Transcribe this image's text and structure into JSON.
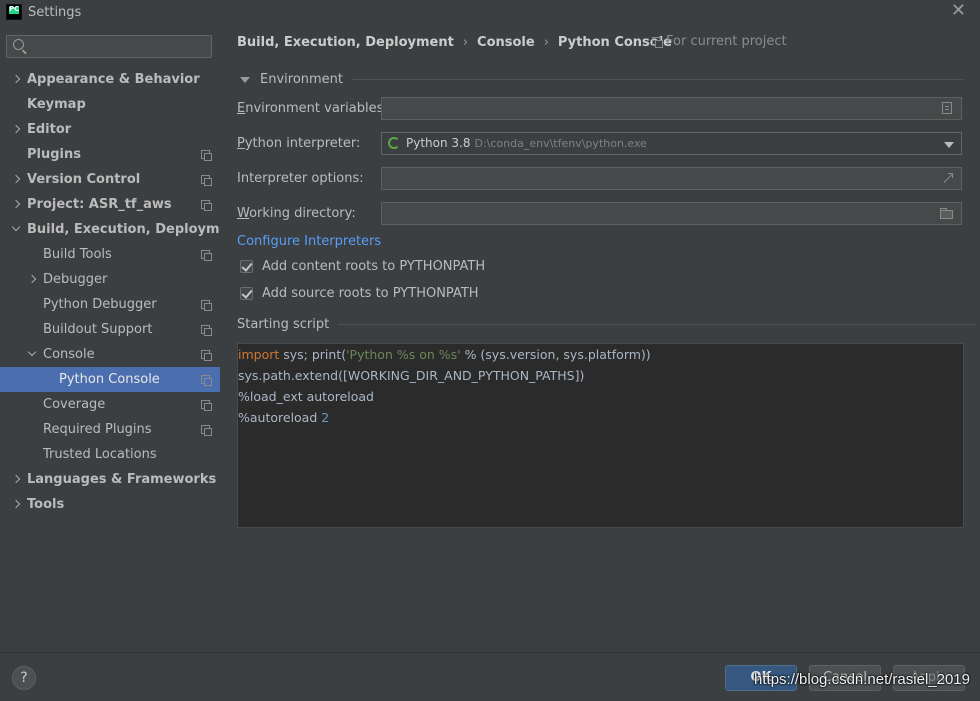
{
  "window": {
    "title": "Settings",
    "app_icon": "pycharm-icon",
    "close_icon": "close-icon"
  },
  "search": {
    "value": "",
    "placeholder": ""
  },
  "sidebar": {
    "items": [
      {
        "label": "Appearance & Behavior",
        "bold": true,
        "chevron": "right",
        "copy": false,
        "level": 0
      },
      {
        "label": "Keymap",
        "bold": true,
        "chevron": "none",
        "copy": false,
        "level": 0
      },
      {
        "label": "Editor",
        "bold": true,
        "chevron": "right",
        "copy": false,
        "level": 0
      },
      {
        "label": "Plugins",
        "bold": true,
        "chevron": "none",
        "copy": true,
        "level": 0
      },
      {
        "label": "Version Control",
        "bold": true,
        "chevron": "right",
        "copy": true,
        "level": 0
      },
      {
        "label": "Project: ASR_tf_aws",
        "bold": true,
        "chevron": "right",
        "copy": true,
        "level": 0
      },
      {
        "label": "Build, Execution, Deployment",
        "bold": true,
        "chevron": "down",
        "copy": false,
        "level": 0
      },
      {
        "label": "Build Tools",
        "bold": false,
        "chevron": "none",
        "copy": true,
        "level": 1
      },
      {
        "label": "Debugger",
        "bold": false,
        "chevron": "right",
        "copy": false,
        "level": 1
      },
      {
        "label": "Python Debugger",
        "bold": false,
        "chevron": "none",
        "copy": true,
        "level": 1
      },
      {
        "label": "Buildout Support",
        "bold": false,
        "chevron": "none",
        "copy": true,
        "level": 1
      },
      {
        "label": "Console",
        "bold": false,
        "chevron": "down",
        "copy": true,
        "level": 1
      },
      {
        "label": "Python Console",
        "bold": false,
        "chevron": "none",
        "copy": true,
        "level": 2,
        "selected": true
      },
      {
        "label": "Coverage",
        "bold": false,
        "chevron": "none",
        "copy": true,
        "level": 1
      },
      {
        "label": "Required Plugins",
        "bold": false,
        "chevron": "none",
        "copy": true,
        "level": 1
      },
      {
        "label": "Trusted Locations",
        "bold": false,
        "chevron": "none",
        "copy": false,
        "level": 1
      },
      {
        "label": "Languages & Frameworks",
        "bold": true,
        "chevron": "right",
        "copy": false,
        "level": 0
      },
      {
        "label": "Tools",
        "bold": true,
        "chevron": "right",
        "copy": false,
        "level": 0
      }
    ]
  },
  "header": {
    "breadcrumb": [
      "Build, Execution, Deployment",
      "Console",
      "Python Console"
    ],
    "separator": "›",
    "scope": "For current project"
  },
  "environment": {
    "title": "Environment",
    "env_vars": {
      "label_first": "E",
      "label_rest": "nvironment variables:",
      "value": ""
    },
    "interpreter": {
      "label_first": "P",
      "label_rest": "ython interpreter:",
      "name": "Python 3.8",
      "path": "D:\\conda_env\\tfenv\\python.exe"
    },
    "interp_options": {
      "label": "Interpreter options:",
      "value": ""
    },
    "working_dir": {
      "label_first": "W",
      "label_rest": "orking directory:",
      "value": ""
    },
    "configure_link": "Configure Interpreters",
    "add_content_roots": {
      "label": "Add content roots to PYTHONPATH",
      "checked": true
    },
    "add_source_roots": {
      "label": "Add source roots to PYTHONPATH",
      "checked": true
    }
  },
  "starting_script": {
    "title": "Starting script",
    "line1": {
      "kw": "import",
      "a": " sys; print(",
      "str": "'Python %s on %s'",
      "b": " % (sys.version, sys.platform))"
    },
    "line2": "sys.path.extend([WORKING_DIR_AND_PYTHON_PATHS])",
    "line3": "%load_ext autoreload",
    "line4": {
      "a": "%autoreload ",
      "num": "2"
    }
  },
  "footer": {
    "help": "?",
    "ok": "OK",
    "cancel": "Cancel",
    "apply": "Apply",
    "watermark": "https://blog.csdn.net/rasiel_2019"
  },
  "colors": {
    "accent": "#4b6eaf",
    "link": "#589df6",
    "keyword": "#cc7832",
    "string": "#6a8759",
    "number": "#6897bb"
  }
}
